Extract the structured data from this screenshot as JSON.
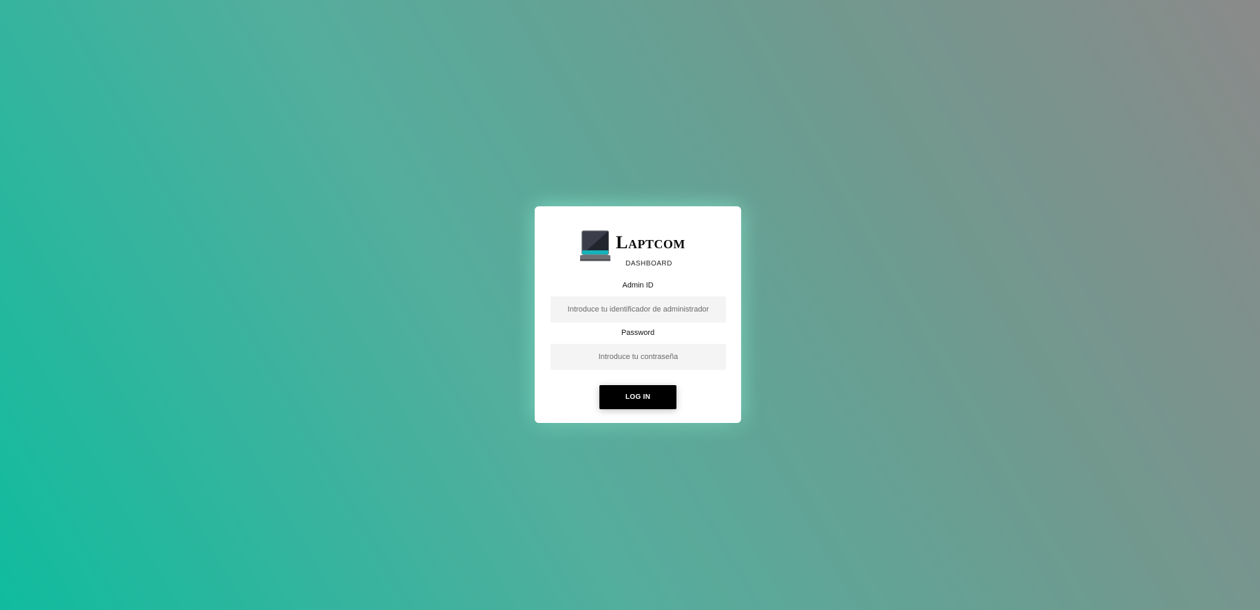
{
  "brand": {
    "name": "Laptcom",
    "subtitle": "DASHBOARD",
    "icon": "laptop-icon",
    "accent_color": "#17b1b8"
  },
  "form": {
    "admin_id_label": "Admin ID",
    "admin_id_placeholder": "Introduce tu identificador de administrador",
    "password_label": "Password",
    "password_placeholder": "Introduce tu contraseña",
    "login_label": "LOG IN"
  },
  "colors": {
    "background_start": "#10bc9e",
    "background_end": "#8a8a8a",
    "button": "#000000",
    "input_bg": "#f4f4f4"
  }
}
